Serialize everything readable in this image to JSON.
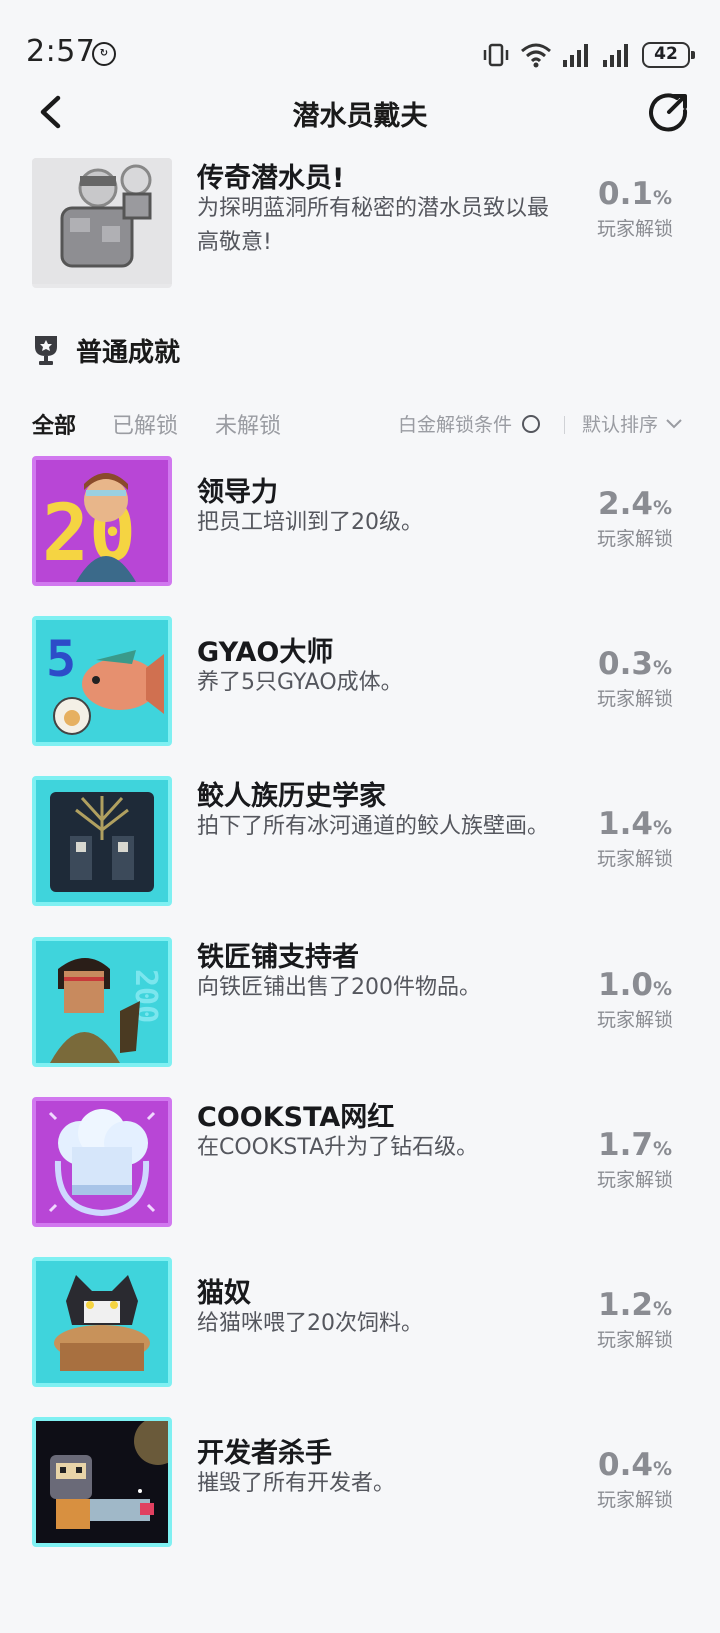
{
  "status_bar": {
    "time": "2:57",
    "battery": "42"
  },
  "header": {
    "title": "潜水员戴夫"
  },
  "legend": {
    "title": "传奇潜水员!",
    "desc": "为探明蓝洞所有秘密的潜水员致以最高敬意!",
    "pct": "0.1",
    "pct_sign": "%",
    "pct_label": "玩家解锁"
  },
  "section": {
    "title": "普通成就"
  },
  "filters": {
    "tabs": [
      "全部",
      "已解锁",
      "未解锁"
    ],
    "platinum_label": "白金解锁条件",
    "sort_label": "默认排序"
  },
  "achievements": [
    {
      "title": "领导力",
      "desc": "把员工培训到了20级。",
      "pct": "2.4",
      "pct_sign": "%",
      "pct_label": "玩家解锁",
      "icon": "leadership-icon",
      "frame": "purple"
    },
    {
      "title": "GYAO大师",
      "desc": "养了5只GYAO成体。",
      "pct": "0.3",
      "pct_sign": "%",
      "pct_label": "玩家解锁",
      "icon": "fish-icon",
      "frame": "cyan"
    },
    {
      "title": "鲛人族历史学家",
      "desc": "拍下了所有冰河通道的鲛人族壁画。",
      "pct": "1.4",
      "pct_sign": "%",
      "pct_label": "玩家解锁",
      "icon": "mural-icon",
      "frame": "cyan"
    },
    {
      "title": "铁匠铺支持者",
      "desc": "向铁匠铺出售了200件物品。",
      "pct": "1.0",
      "pct_sign": "%",
      "pct_label": "玩家解锁",
      "icon": "blacksmith-icon",
      "frame": "cyan"
    },
    {
      "title": "COOKSTA网红",
      "desc": "在COOKSTA升为了钻石级。",
      "pct": "1.7",
      "pct_sign": "%",
      "pct_label": "玩家解锁",
      "icon": "chef-hat-icon",
      "frame": "purple"
    },
    {
      "title": "猫奴",
      "desc": "给猫咪喂了20次饲料。",
      "pct": "1.2",
      "pct_sign": "%",
      "pct_label": "玩家解锁",
      "icon": "cat-icon",
      "frame": "cyan"
    },
    {
      "title": "开发者杀手",
      "desc": "摧毁了所有开发者。",
      "pct": "0.4",
      "pct_sign": "%",
      "pct_label": "玩家解锁",
      "icon": "dev-killer-icon",
      "frame": "cyan"
    }
  ]
}
